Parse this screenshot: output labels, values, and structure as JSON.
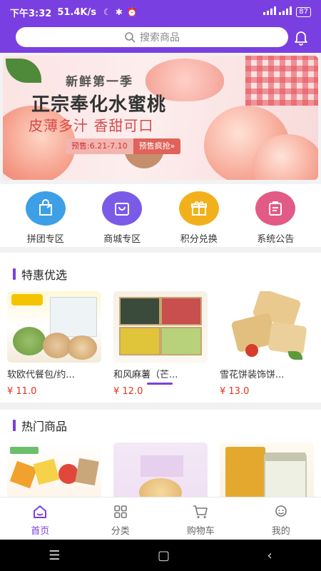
{
  "status_bar": {
    "time": "下午3:32",
    "speed": "51.4K/s",
    "battery": "87"
  },
  "search": {
    "placeholder": "搜索商品"
  },
  "banner": {
    "subtitle": "新鲜第一季",
    "title": "正宗奉化水蜜桃",
    "slogan": "皮薄多汁 香甜可口",
    "presale_date": "预售:6.21-7.10",
    "presale_cta": "预售疯抢»"
  },
  "quick_menu": [
    {
      "label": "拼团专区",
      "icon": "group-buy-icon",
      "color": "#3d9fe6"
    },
    {
      "label": "商城专区",
      "icon": "shopping-bag-icon",
      "color": "#7a5be8"
    },
    {
      "label": "积分兑换",
      "icon": "gift-icon",
      "color": "#f2b11c"
    },
    {
      "label": "系统公告",
      "icon": "notice-icon",
      "color": "#e25a86"
    }
  ],
  "special": {
    "title": "特惠优选",
    "items": [
      {
        "name": "软欧代餐包/约...",
        "price": "¥ 11.0"
      },
      {
        "name": "和风麻薯（芒...",
        "price": "¥ 12.0"
      },
      {
        "name": "雪花饼装饰饼...",
        "price": "¥ 13.0"
      }
    ]
  },
  "hot": {
    "title": "热门商品"
  },
  "tabbar": [
    {
      "label": "首页",
      "icon": "home-icon"
    },
    {
      "label": "分类",
      "icon": "category-icon"
    },
    {
      "label": "购物车",
      "icon": "cart-icon"
    },
    {
      "label": "我的",
      "icon": "profile-icon"
    }
  ],
  "colors": {
    "accent": "#7a3fe0",
    "price": "#e0341e"
  }
}
